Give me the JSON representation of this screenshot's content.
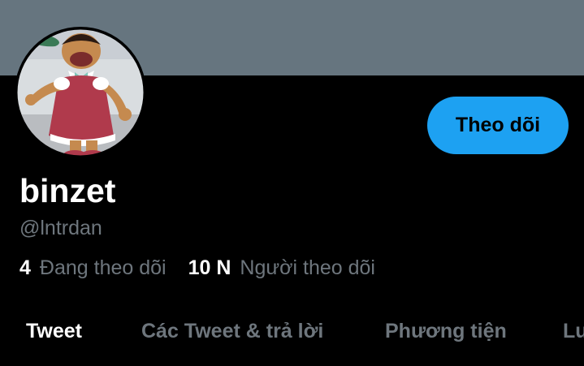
{
  "colors": {
    "background": "#000000",
    "banner": "#66757f",
    "accent": "#1da1f2",
    "primary_text": "#ffffff",
    "secondary_text": "#6e767d"
  },
  "profile": {
    "display_name": "binzet",
    "handle": "@lntrdan",
    "avatar_icon": "cartoon-character-avatar"
  },
  "actions": {
    "follow_label": "Theo dõi"
  },
  "stats": {
    "following_count": "4",
    "following_label": "Đang theo dõi",
    "followers_count": "10 N",
    "followers_label": "Người theo dõi"
  },
  "tabs": [
    {
      "label": "Tweet",
      "active": true
    },
    {
      "label": "Các Tweet & trả lời",
      "active": false
    },
    {
      "label": "Phương tiện",
      "active": false
    },
    {
      "label": "Lu",
      "active": false
    }
  ]
}
